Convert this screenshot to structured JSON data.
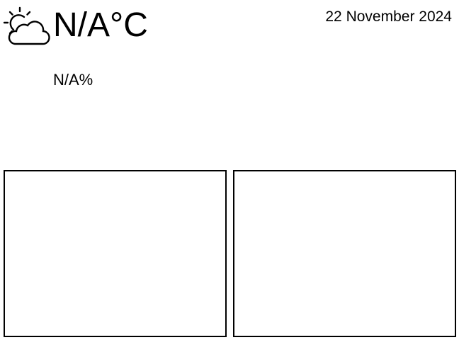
{
  "weather": {
    "icon": "partly-cloudy-icon",
    "temperature": "N/A°C",
    "humidity": "N/A%"
  },
  "date": "22 November 2024",
  "panels": [
    {
      "content": ""
    },
    {
      "content": ""
    }
  ],
  "colors": {
    "foreground": "#000000",
    "background": "#ffffff"
  }
}
